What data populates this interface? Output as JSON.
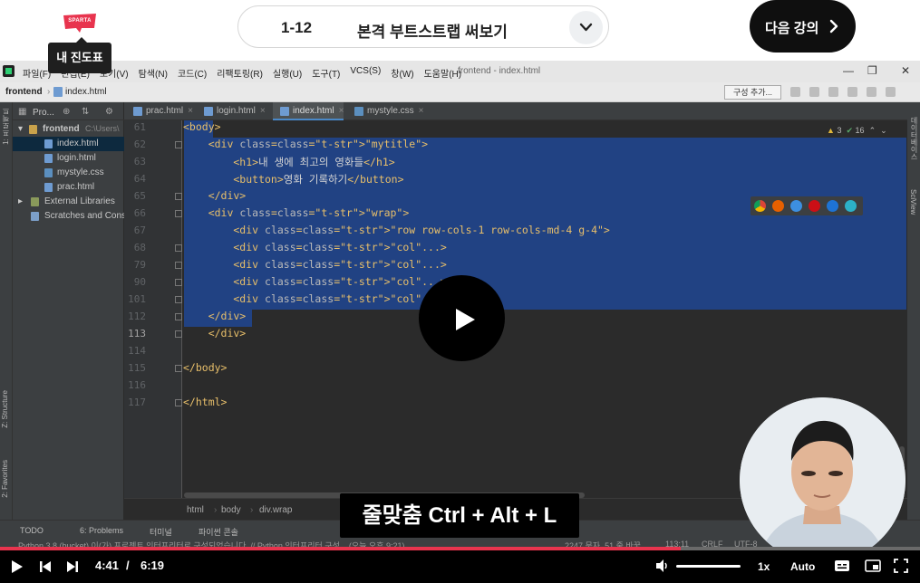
{
  "header": {
    "logo_text": "SPARTA",
    "progress_tooltip": "내 진도표",
    "lesson_number": "1-12",
    "lesson_title": "본격 부트스트랩 써보기",
    "next_button": "다음 강의"
  },
  "ide": {
    "menu": [
      "파일(F)",
      "편집(E)",
      "보기(V)",
      "탐색(N)",
      "코드(C)",
      "리팩토링(R)",
      "실행(U)",
      "도구(T)",
      "VCS(S)",
      "창(W)",
      "도움말(H)"
    ],
    "window_title": "frontend - index.html",
    "breadcrumb": {
      "project": "frontend",
      "file": "index.html"
    },
    "config_button": "구성 추가...",
    "project_panel": {
      "title": "Pro...",
      "root": "frontend",
      "root_hint": "C:\\Users\\",
      "files": [
        "index.html",
        "login.html",
        "mystyle.css",
        "prac.html"
      ],
      "external": "External Libraries",
      "scratches": "Scratches and Conso"
    },
    "tabs": [
      "prac.html",
      "login.html",
      "index.html",
      "mystyle.css"
    ],
    "active_tab": "index.html",
    "inspection": {
      "warnings": "3",
      "ok": "16"
    },
    "code": [
      {
        "n": "61",
        "t": "<body>"
      },
      {
        "n": "62",
        "t": "    <div class=\"mytitle\">"
      },
      {
        "n": "63",
        "t": "        <h1>내 생에 최고의 영화들</h1>"
      },
      {
        "n": "64",
        "t": "        <button>영화 기록하기</button>"
      },
      {
        "n": "65",
        "t": "    </div>"
      },
      {
        "n": "66",
        "t": "    <div class=\"wrap\">"
      },
      {
        "n": "67",
        "t": "        <div class=\"row row-cols-1 row-cols-md-4 g-4\">"
      },
      {
        "n": "68",
        "t": "        <div class=\"col\"...>"
      },
      {
        "n": "79",
        "t": "        <div class=\"col\"...>"
      },
      {
        "n": "90",
        "t": "        <div class=\"col\"...>"
      },
      {
        "n": "101",
        "t": "        <div class=\"col\"...>"
      },
      {
        "n": "112",
        "t": "    </div>"
      },
      {
        "n": "113",
        "t": "    </div>"
      },
      {
        "n": "114",
        "t": ""
      },
      {
        "n": "115",
        "t": "</body>"
      },
      {
        "n": "116",
        "t": ""
      },
      {
        "n": "117",
        "t": "</html>"
      }
    ],
    "editor_breadcrumb": [
      "html",
      "body",
      "div.wrap"
    ],
    "left_labels": [
      "1: 프로젝트",
      "Z: Structure",
      "2: Favorites"
    ],
    "right_labels": [
      "데이터베이스",
      "SciView"
    ],
    "bottom_tools": [
      "TODO",
      "6: Problems",
      "터미널",
      "파이썬 콘솔"
    ],
    "status_text": "Python 3.8 (bucket) 이(가) 프로젝트 인터프리터로 구성되었습니다. // Python 인터프리터 구성... (오늘 오후 9:21)",
    "status_right": [
      "2247 문자, 51 줄 바꿈",
      "113:11",
      "CRLF",
      "UTF-8"
    ]
  },
  "overlay": {
    "shortcut_caption": "줄맞춤 Ctrl + Alt + L"
  },
  "player": {
    "current_time": "4:41",
    "separator": "/",
    "duration": "6:19",
    "speed": "1x",
    "quality": "Auto",
    "progress": 0.74
  },
  "colors": {
    "accent": "#e8344e",
    "selection": "#214283"
  }
}
